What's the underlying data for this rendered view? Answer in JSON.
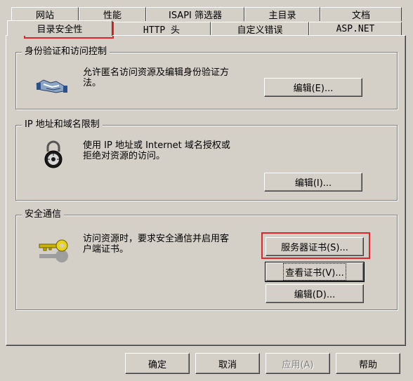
{
  "tabs_back": [
    "网站",
    "性能",
    "ISAPI 筛选器",
    "主目录",
    "文档"
  ],
  "tabs_front": [
    "目录安全性",
    "HTTP 头",
    "自定义错误",
    "ASP.NET"
  ],
  "groups": {
    "auth": {
      "title": "身份验证和访问控制",
      "desc_line1": "允许匿名访问资源及编辑身份验证方",
      "desc_line2": "法。",
      "button": "编辑(E)..."
    },
    "ip": {
      "title": "IP 地址和域名限制",
      "desc_line1": "使用 IP 地址或 Internet 域名授权或",
      "desc_line2": "拒绝对资源的访问。",
      "button": "编辑(I)..."
    },
    "secure": {
      "title": "安全通信",
      "desc_line1": "访问资源时，要求安全通信并启用客",
      "desc_line2": "户端证书。",
      "button_server_cert": "服务器证书(S)...",
      "button_view_cert": "查看证书(V)...",
      "button_edit": "编辑(D)..."
    }
  },
  "footer": {
    "ok": "确定",
    "cancel": "取消",
    "apply": "应用(A)",
    "help": "帮助"
  },
  "icons": {
    "auth": "handshake-icon",
    "ip": "padlock-icon",
    "secure": "key-icon"
  },
  "highlight_color": "#e0262a"
}
